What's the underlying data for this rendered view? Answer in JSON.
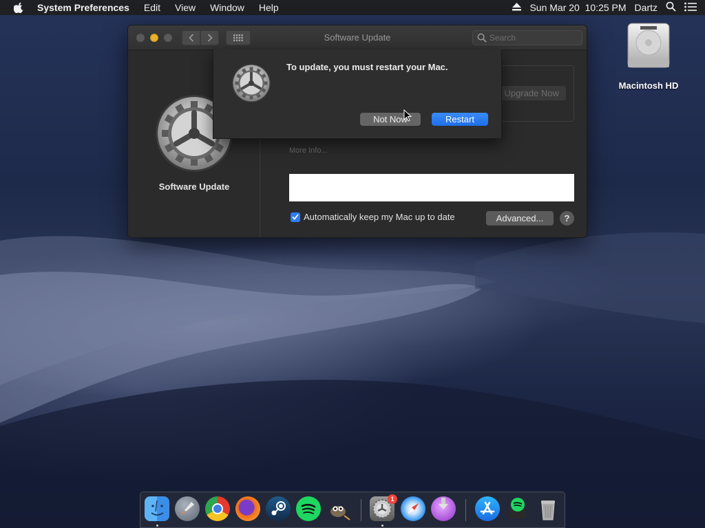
{
  "menubar": {
    "app_name": "System Preferences",
    "items": [
      "Edit",
      "View",
      "Window",
      "Help"
    ],
    "datetime": "Sun Mar 20  10:25 PM",
    "user": "Dartz"
  },
  "window": {
    "title": "Software Update",
    "search_placeholder": "Search",
    "sidebar_label": "Software Update",
    "upgrade_label": "Upgrade Now",
    "more_info": "More Info...",
    "auto_update_label": "Automatically keep my Mac up to date",
    "auto_update_checked": true,
    "advanced_label": "Advanced...",
    "help_label": "?"
  },
  "alert": {
    "message": "To update, you must restart your Mac.",
    "not_now_label": "Not Now",
    "restart_label": "Restart"
  },
  "desktop": {
    "drive_label": "Macintosh HD"
  },
  "dock": {
    "apps": [
      "Finder",
      "Launchpad",
      "Chrome",
      "Firefox",
      "Steam",
      "Spotify",
      "GIMP",
      "System Preferences",
      "Safari",
      "Downloader",
      "App Store",
      "Spotify Installer",
      "Trash"
    ],
    "badge_count": "1"
  },
  "colors": {
    "accent": "#1f6ee8",
    "checkbox": "#2f7cf6",
    "badge": "#f0433a"
  }
}
